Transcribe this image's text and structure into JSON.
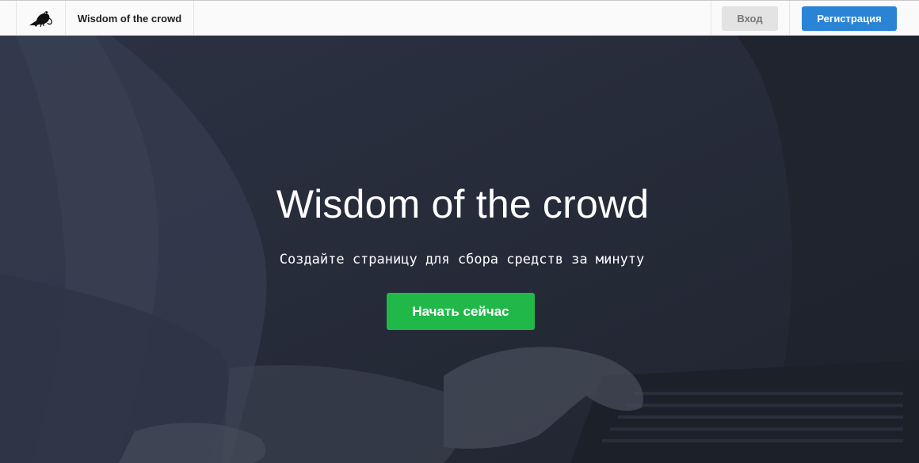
{
  "header": {
    "logo_icon": "crow-icon",
    "brand": "Wisdom of the crowd",
    "login_label": "Вход",
    "register_label": "Регистрация",
    "colors": {
      "login_bg": "#e3e3e3",
      "register_bg": "#2a84d6"
    }
  },
  "hero": {
    "title": "Wisdom of the crowd",
    "subtitle": "Создайте страницу для сбора средств за минуту",
    "cta_label": "Начать сейчас",
    "background_image": "person-typing-on-laptop",
    "colors": {
      "overlay": "#262b38",
      "cta_bg": "#21b84a"
    }
  }
}
